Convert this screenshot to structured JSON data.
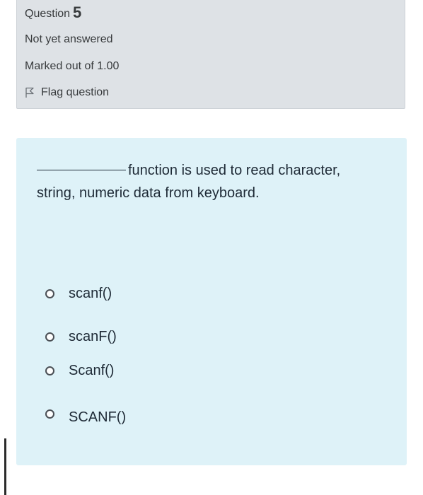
{
  "info": {
    "question_label": "Question",
    "question_number": "5",
    "state": "Not yet answered",
    "grade": "Marked out of 1.00",
    "flag_label": "Flag question"
  },
  "question": {
    "text_part1": "function is used to read character,",
    "text_part2": "string, numeric data from keyboard.",
    "options": [
      {
        "label": "scanf()"
      },
      {
        "label": "scanF()"
      },
      {
        "label": "Scanf()"
      },
      {
        "label": "SCANF()"
      }
    ]
  },
  "colors": {
    "info_bg": "#dee2e6",
    "question_bg": "#def2f8",
    "text": "#1e2a36"
  },
  "icons": {
    "flag": "flag-icon",
    "radio": "radio-unchecked-icon"
  }
}
